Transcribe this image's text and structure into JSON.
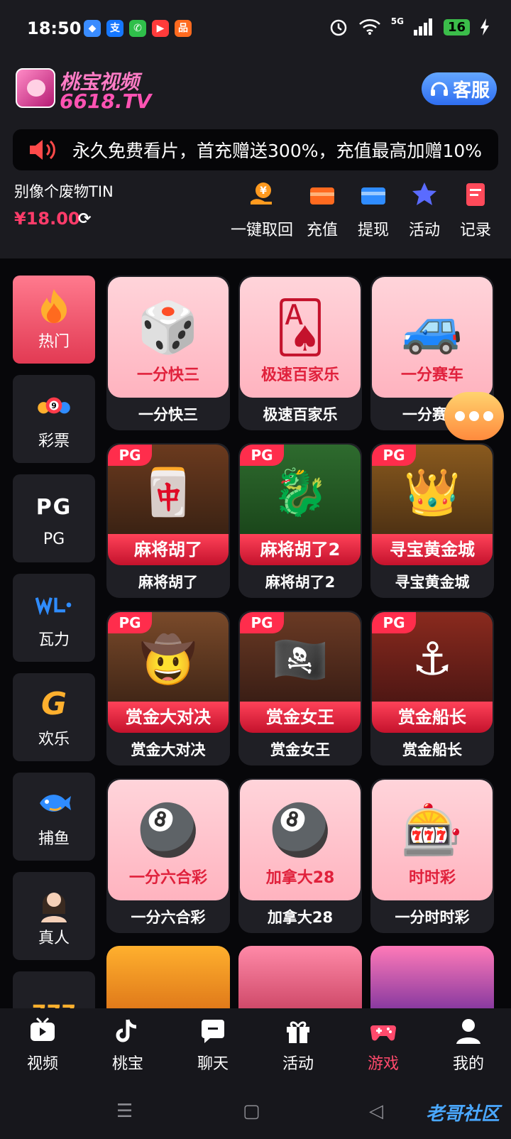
{
  "status_bar": {
    "time": "18:50",
    "network": "5G",
    "battery": "16",
    "apps": [
      {
        "icon": "browser-icon",
        "color": "#3a8cff",
        "glyph": "◆"
      },
      {
        "icon": "alipay-icon",
        "color": "#1677ff",
        "glyph": "支"
      },
      {
        "icon": "phone-icon",
        "color": "#2fbf4a",
        "glyph": "✆"
      },
      {
        "icon": "video-icon",
        "color": "#ff3b3b",
        "glyph": "▶"
      },
      {
        "icon": "shop-icon",
        "color": "#ff6a1f",
        "glyph": "品"
      }
    ]
  },
  "header": {
    "logo_cn": "桃宝视频",
    "logo_en": "6618.TV",
    "service_label": "客服",
    "notice": "永久免费看片，首充赠送300%，充值最高加赠10%",
    "username": "别像个废物TIN",
    "balance": "¥18.00",
    "actions": [
      {
        "label": "一键取回",
        "icon": "retrieve-icon",
        "color": "#ff9a1f"
      },
      {
        "label": "充值",
        "icon": "recharge-icon",
        "color": "#ff6a1f"
      },
      {
        "label": "提现",
        "icon": "withdraw-icon",
        "color": "#2f8cff"
      },
      {
        "label": "活动",
        "icon": "activity-icon",
        "color": "#5a6bff"
      },
      {
        "label": "记录",
        "icon": "record-icon",
        "color": "#ff4a5a"
      }
    ]
  },
  "sidebar": {
    "items": [
      {
        "label": "热门",
        "icon": "flame-icon",
        "active": true
      },
      {
        "label": "彩票",
        "icon": "lottery-balls-icon"
      },
      {
        "label": "PG",
        "icon": "pg-logo-icon"
      },
      {
        "label": "瓦力",
        "icon": "wl-logo-icon"
      },
      {
        "label": "欢乐",
        "icon": "happy-logo-icon"
      },
      {
        "label": "捕鱼",
        "icon": "fish-icon"
      },
      {
        "label": "真人",
        "icon": "live-dealer-icon"
      },
      {
        "label": "",
        "icon": "slot-777-icon"
      }
    ]
  },
  "games": [
    {
      "name": "一分快三",
      "thumb": "一分快三",
      "style": "pink",
      "art": "🎲"
    },
    {
      "name": "极速百家乐",
      "thumb": "极速百家乐",
      "style": "pink",
      "art": "🂡"
    },
    {
      "name": "一分赛车",
      "thumb": "一分赛车",
      "style": "pink",
      "art": "🚙"
    },
    {
      "name": "麻将胡了",
      "thumb": "麻将胡了",
      "style": "pg",
      "art": "🀄"
    },
    {
      "name": "麻将胡了2",
      "thumb": "麻将胡了2",
      "style": "pg",
      "art": "🐉"
    },
    {
      "name": "寻宝黄金城",
      "thumb": "寻宝黄金城",
      "style": "pg",
      "art": "👑"
    },
    {
      "name": "赏金大对决",
      "thumb": "赏金大对决",
      "style": "pg",
      "art": "🤠"
    },
    {
      "name": "赏金女王",
      "thumb": "赏金女王",
      "style": "pg",
      "art": "🏴‍☠️"
    },
    {
      "name": "赏金船长",
      "thumb": "赏金船长",
      "style": "pg",
      "art": "⚓"
    },
    {
      "name": "一分六合彩",
      "thumb": "一分六合彩",
      "style": "pink",
      "art": "🎱"
    },
    {
      "name": "加拿大28",
      "thumb": "加拿大28",
      "style": "pink",
      "art": "🎱"
    },
    {
      "name": "一分时时彩",
      "thumb": "时时彩",
      "style": "pink",
      "art": "🎰"
    }
  ],
  "bottom_nav": [
    {
      "label": "视频",
      "icon": "tv-icon"
    },
    {
      "label": "桃宝",
      "icon": "tiktok-icon"
    },
    {
      "label": "聊天",
      "icon": "chat-icon"
    },
    {
      "label": "活动",
      "icon": "gift-icon"
    },
    {
      "label": "游戏",
      "icon": "gamepad-icon",
      "active": true
    },
    {
      "label": "我的",
      "icon": "profile-icon"
    }
  ],
  "watermark": "老哥社区",
  "colors": {
    "accent": "#ff4a6c",
    "balance": "#ff3c6a",
    "service": "#2f6ef0"
  }
}
